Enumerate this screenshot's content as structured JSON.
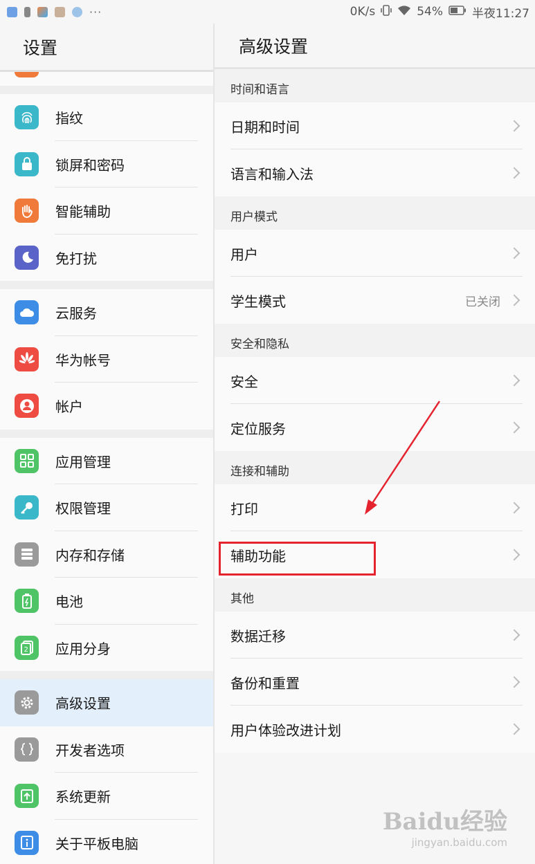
{
  "status_bar": {
    "speed": "0K/s",
    "battery": "54%",
    "time": "半夜11:27",
    "more": "···"
  },
  "left_pane": {
    "title": "设置",
    "groups": [
      [
        {
          "label": "指纹",
          "icon": "fingerprint-icon",
          "color": "#3ab7c8"
        },
        {
          "label": "锁屏和密码",
          "icon": "lock-icon",
          "color": "#3ab7c8"
        },
        {
          "label": "智能辅助",
          "icon": "hand-icon",
          "color": "#f07a3a"
        },
        {
          "label": "免打扰",
          "icon": "moon-icon",
          "color": "#5a63c8"
        }
      ],
      [
        {
          "label": "云服务",
          "icon": "cloud-icon",
          "color": "#3d8de6"
        },
        {
          "label": "华为帐号",
          "icon": "huawei-icon",
          "color": "#ee4b43"
        },
        {
          "label": "帐户",
          "icon": "account-icon",
          "color": "#ee4b43"
        }
      ],
      [
        {
          "label": "应用管理",
          "icon": "apps-icon",
          "color": "#4fc466"
        },
        {
          "label": "权限管理",
          "icon": "key-icon",
          "color": "#3ab7c8"
        },
        {
          "label": "内存和存储",
          "icon": "storage-icon",
          "color": "#9a9a9a"
        },
        {
          "label": "电池",
          "icon": "battery-icon",
          "color": "#4fc466"
        },
        {
          "label": "应用分身",
          "icon": "app-twin-icon",
          "color": "#4fc466"
        }
      ],
      [
        {
          "label": "高级设置",
          "icon": "gear-icon",
          "color": "#9a9a9a",
          "active": true
        },
        {
          "label": "开发者选项",
          "icon": "braces-icon",
          "color": "#9a9a9a"
        },
        {
          "label": "系统更新",
          "icon": "update-icon",
          "color": "#4fc466"
        },
        {
          "label": "关于平板电脑",
          "icon": "info-icon",
          "color": "#3d8de6"
        }
      ]
    ]
  },
  "right_pane": {
    "title": "高级设置",
    "sections": [
      {
        "header": "时间和语言",
        "items": [
          {
            "label": "日期和时间"
          },
          {
            "label": "语言和输入法"
          }
        ]
      },
      {
        "header": "用户模式",
        "items": [
          {
            "label": "用户"
          },
          {
            "label": "学生模式",
            "value": "已关闭"
          }
        ]
      },
      {
        "header": "安全和隐私",
        "items": [
          {
            "label": "安全"
          },
          {
            "label": "定位服务"
          }
        ]
      },
      {
        "header": "连接和辅助",
        "items": [
          {
            "label": "打印"
          },
          {
            "label": "辅助功能",
            "highlighted": true
          }
        ]
      },
      {
        "header": "其他",
        "items": [
          {
            "label": "数据迁移"
          },
          {
            "label": "备份和重置"
          },
          {
            "label": "用户体验改进计划"
          }
        ]
      }
    ]
  },
  "annotation": {
    "color": "#e5232e"
  },
  "watermark": {
    "main": "Baidu经验",
    "sub": "jingyan.baidu.com"
  }
}
